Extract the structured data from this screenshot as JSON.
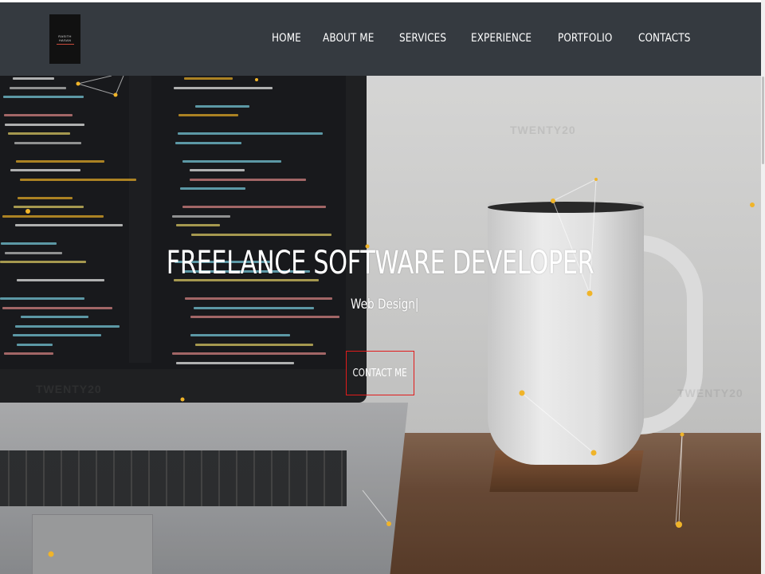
{
  "logo": {
    "lines": [
      "RASITH",
      "HASAN"
    ]
  },
  "nav": {
    "items": [
      {
        "label": "HOME"
      },
      {
        "label": "ABOUT ME"
      },
      {
        "label": "SERVICES"
      },
      {
        "label": "EXPERIENCE"
      },
      {
        "label": "PORTFOLIO"
      },
      {
        "label": "CONTACTS"
      }
    ]
  },
  "hero": {
    "title": "FREELANCE SOFTWARE DEVELOPER",
    "subtitle": "Web Design|",
    "cta_label": "CONTACT ME"
  },
  "watermark": "TWENTY20",
  "colors": {
    "navbar": "#353a40",
    "cta_border": "#e11b1b",
    "particle": "#f0b429"
  }
}
